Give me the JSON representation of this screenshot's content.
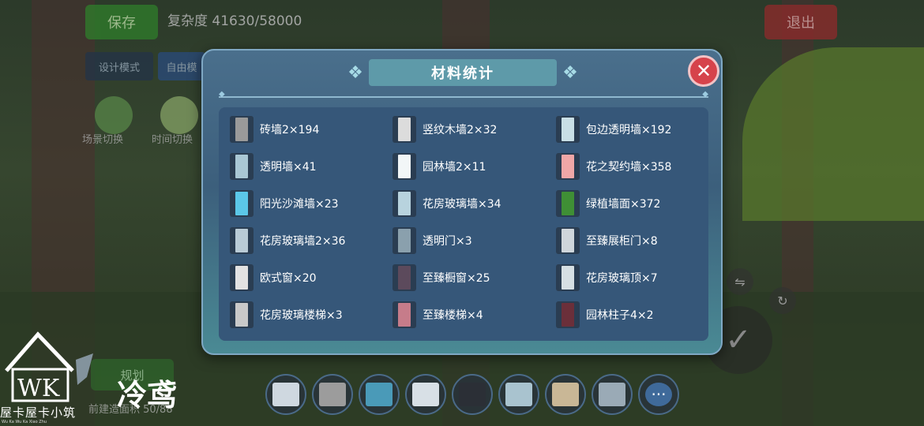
{
  "hud": {
    "save_label": "保存",
    "complexity": "复杂度 41630/58000",
    "exit_label": "退出",
    "mode_design": "设计模式",
    "mode_free": "自由模",
    "scene_switch": "场景切换",
    "time_switch": "时间切换",
    "bottom_left_btn": "规划",
    "bottom_left_label": "前建造面积 50/88"
  },
  "modal": {
    "title": "材料统计",
    "close_label": "✕"
  },
  "materials": [
    {
      "label": "砖墙2×194",
      "color": "#9a9a9a"
    },
    {
      "label": "竖纹木墙2×32",
      "color": "#dcdcdc"
    },
    {
      "label": "包边透明墙×192",
      "color": "#c9dfe6"
    },
    {
      "label": "透明墙×41",
      "color": "#a9c7d4"
    },
    {
      "label": "园林墙2×11",
      "color": "#f2f6f7"
    },
    {
      "label": "花之契约墙×358",
      "color": "#f0a7a7"
    },
    {
      "label": "阳光沙滩墙×23",
      "color": "#5bc7e8"
    },
    {
      "label": "花房玻璃墙×34",
      "color": "#b8d3de"
    },
    {
      "label": "绿植墙面×372",
      "color": "#3f8f35"
    },
    {
      "label": "花房玻璃墙2×36",
      "color": "#b9cbd6"
    },
    {
      "label": "透明门×3",
      "color": "#8aa0ad"
    },
    {
      "label": "至臻展柜门×8",
      "color": "#cfd6db"
    },
    {
      "label": "欧式窗×20",
      "color": "#e2e2e2"
    },
    {
      "label": "至臻橱窗×25",
      "color": "#5c4a5c"
    },
    {
      "label": "花房玻璃顶×7",
      "color": "#d6dfe3"
    },
    {
      "label": "花房玻璃楼梯×3",
      "color": "#c9c9c9"
    },
    {
      "label": "至臻楼梯×4",
      "color": "#c67c8a"
    },
    {
      "label": "园林柱子4×2",
      "color": "#6b2f3a"
    }
  ],
  "toolbar": [
    {
      "name": "eraser-tool",
      "color": "#cfd8e0"
    },
    {
      "name": "brick-wall-tool",
      "color": "#9c9c9c"
    },
    {
      "name": "arch-door-tool",
      "color": "#4a9ab8"
    },
    {
      "name": "window-tool",
      "color": "#d8e0e6"
    },
    {
      "name": "dark-glass-tool",
      "color": "#2b2f36"
    },
    {
      "name": "glass-panel-tool",
      "color": "#a9c3cf"
    },
    {
      "name": "floor-tile-tool",
      "color": "#c9b796"
    },
    {
      "name": "roof-tile-tool",
      "color": "#9aaab6"
    },
    {
      "name": "more-tool",
      "color": "#3f6a9a"
    }
  ],
  "more_label": "···",
  "logo": {
    "main": "屋卡屋卡小筑",
    "sub": "Wu Ka Wu Ka Xiao Zhu",
    "mark": "WK"
  },
  "signature": "冷鸢"
}
